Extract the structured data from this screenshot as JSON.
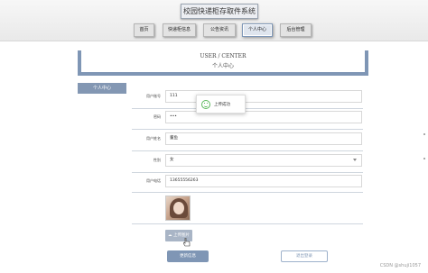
{
  "app": {
    "title": "校园快递柜存取件系统"
  },
  "nav": [
    {
      "label": "首页",
      "active": false
    },
    {
      "label": "快递柜信息",
      "active": false
    },
    {
      "label": "公告资讯",
      "active": false
    },
    {
      "label": "个人中心",
      "active": true
    },
    {
      "label": "后台管理",
      "active": false
    }
  ],
  "center": {
    "heading_en": "USER / CENTER",
    "heading_zh": "个人中心"
  },
  "sidebar": {
    "tab_label": "个人中心"
  },
  "form": {
    "account_label": "用户账号",
    "account_value": "111",
    "password_label": "密码",
    "password_value": "•••",
    "name_label": "用户姓名",
    "name_value": "董鱼",
    "gender_label": "性别",
    "gender_value": "女",
    "phone_label": "用户电话",
    "phone_value": "13655556263"
  },
  "upload": {
    "button_label": "上传图片"
  },
  "actions": {
    "update_label": "更新信息",
    "logout_label": "退出登录"
  },
  "toast": {
    "text": "上传成功"
  },
  "watermark": "CSDN @shuji1057",
  "colors": {
    "accent": "#7f96b5",
    "success": "#5cb85c"
  }
}
